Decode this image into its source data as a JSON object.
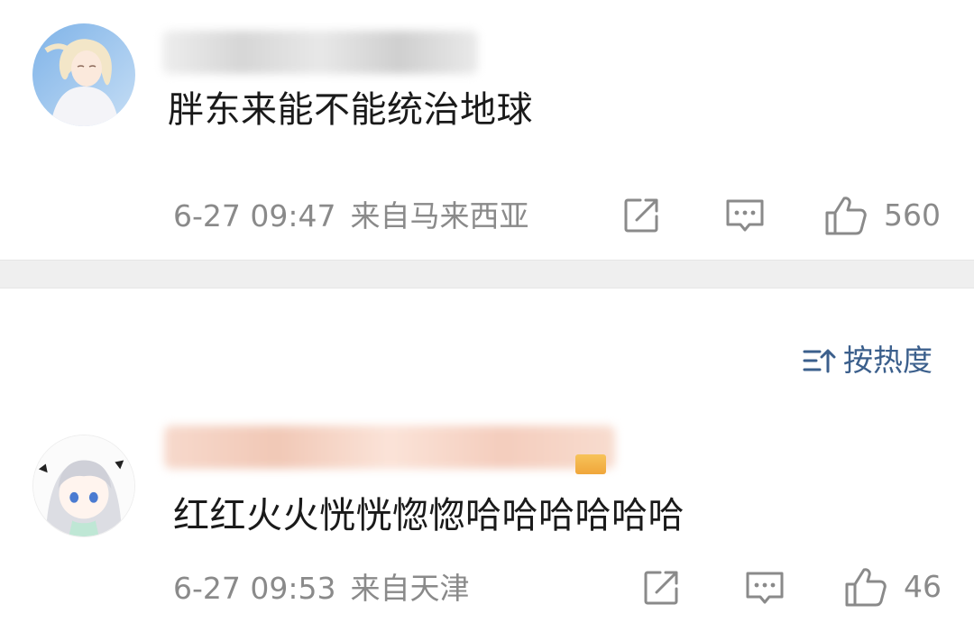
{
  "comments": [
    {
      "text": "胖东来能不能统治地球",
      "time": "6-27 09:47",
      "location": "来自马来西亚",
      "likes": "560",
      "username_blur_color": "#d9d9d9"
    },
    {
      "text": "红红火火恍恍惚惚哈哈哈哈哈哈",
      "time": "6-27 09:53",
      "location": "来自天津",
      "likes": "46",
      "username_blur_color": "#f4d2c2"
    }
  ],
  "sort": {
    "label": "按热度"
  },
  "colors": {
    "meta": "#8a8a8a",
    "link": "#3b5f8c",
    "divider": "#efefef"
  },
  "icons": [
    "share-icon",
    "comment-icon",
    "like-icon",
    "sort-icon"
  ]
}
